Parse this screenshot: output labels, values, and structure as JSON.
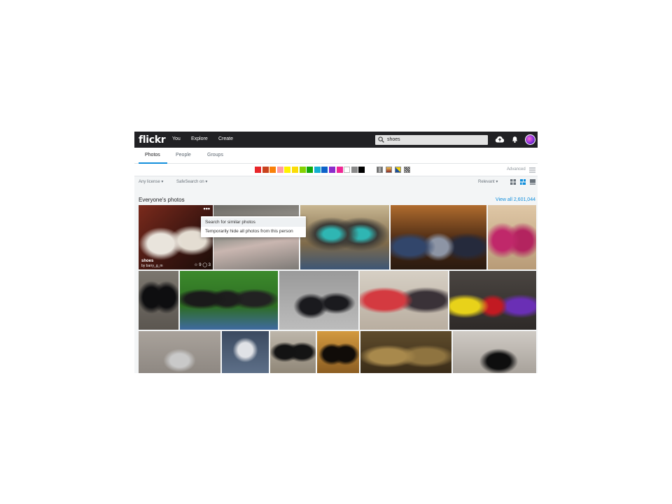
{
  "nav": {
    "logo": "flickr",
    "links": [
      "You",
      "Explore",
      "Create"
    ],
    "search_value": "shoes"
  },
  "subtabs": [
    "Photos",
    "People",
    "Groups"
  ],
  "colors": [
    "#e8262a",
    "#c9421e",
    "#f98109",
    "#ff9ca4",
    "#fff200",
    "#fbdc07",
    "#84d202",
    "#13a80b",
    "#14afd0",
    "#0d62c9",
    "#8b2ccb",
    "#f02795",
    "#ffffff",
    "#8a8a8a",
    "#000000"
  ],
  "advanced_label": "Advanced",
  "filters": {
    "license": "Any license",
    "safesearch": "SafeSearch on",
    "sort": "Relevant"
  },
  "section": {
    "title": "Everyone's photos",
    "view_all": "View all 2,601,044"
  },
  "hover_photo": {
    "title": "shoes",
    "owner": "by barry_g_m",
    "faves": "9",
    "comments": "3",
    "dots": "•••"
  },
  "menu": {
    "items": [
      "Search for similar photos",
      "Temporarily hide all photos from this person"
    ]
  }
}
